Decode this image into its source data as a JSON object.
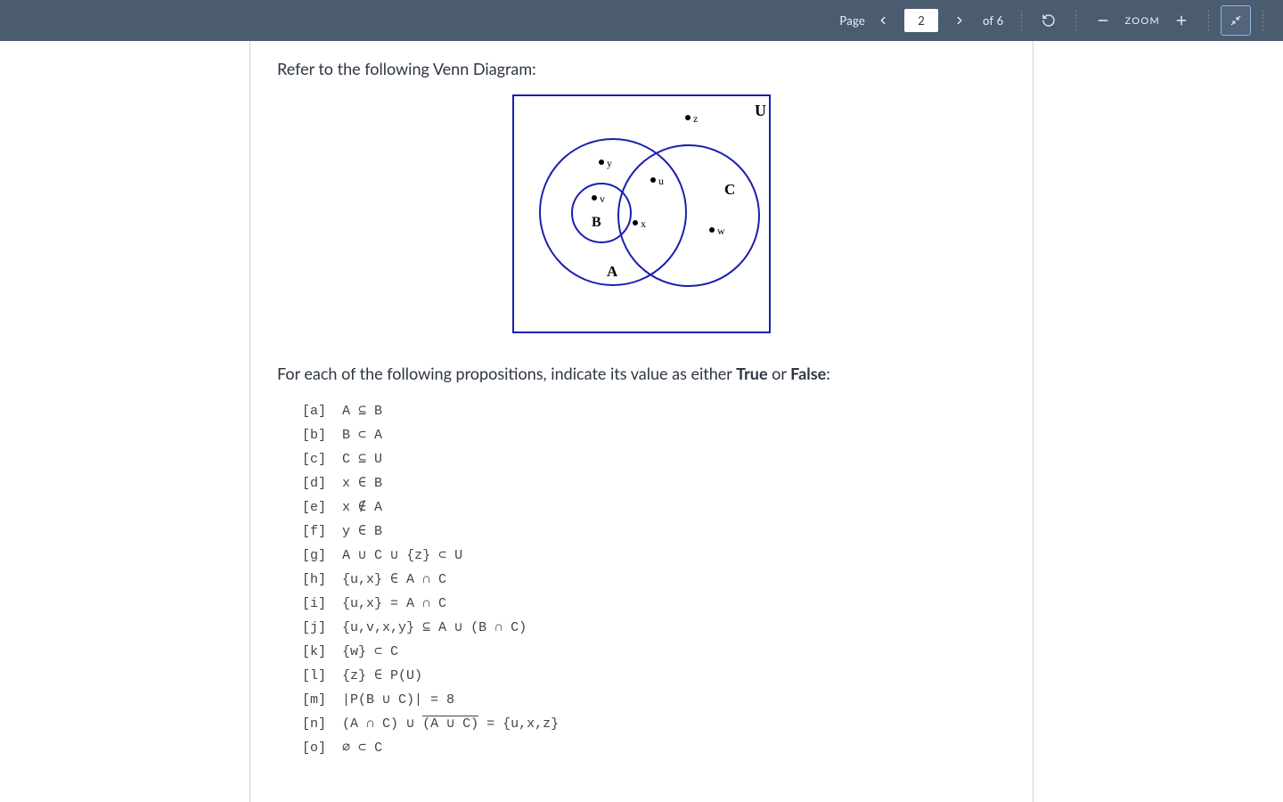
{
  "toolbar": {
    "page_label": "Page",
    "page_value": "2",
    "of_label": "of 6",
    "zoom_label": "ZOOM"
  },
  "content": {
    "prompt": "Refer to the following Venn Diagram:",
    "instruction_pre": "For each of the following propositions, indicate its value as either ",
    "true_word": "True",
    "or_word": " or ",
    "false_word": "False",
    "colon": ":"
  },
  "propositions": [
    {
      "tag": "[a]",
      "expr": "A ⊆ B"
    },
    {
      "tag": "[b]",
      "expr": "B ⊂ A"
    },
    {
      "tag": "[c]",
      "expr": "C ⊆ U"
    },
    {
      "tag": "[d]",
      "expr": "x ∈ B"
    },
    {
      "tag": "[e]",
      "expr": "x ∉ A"
    },
    {
      "tag": "[f]",
      "expr": "y ∈ B"
    },
    {
      "tag": "[g]",
      "expr": "A ∪ C ∪ {z} ⊂ U"
    },
    {
      "tag": "[h]",
      "expr": "{u,x} ∈ A ∩ C"
    },
    {
      "tag": "[i]",
      "expr": "{u,x} = A ∩ C"
    },
    {
      "tag": "[j]",
      "expr": "{u,v,x,y} ⊆ A ∪ (B ∩ C)"
    },
    {
      "tag": "[k]",
      "expr": "{w} ⊂ C"
    },
    {
      "tag": "[l]",
      "expr": "{z} ∈ P(U)"
    },
    {
      "tag": "[m]",
      "expr": "|P(B ∪ C)| = 8"
    },
    {
      "tag": "[n]",
      "expr_pre": "(A ∩ C) ∪ ",
      "expr_over": "(A ∪ C)",
      "expr_post": " = {u,x,z}"
    },
    {
      "tag": "[o]",
      "expr": "∅ ⊂ C"
    }
  ],
  "venn": {
    "U": "U",
    "A": "A",
    "B": "B",
    "C": "C",
    "u": "u",
    "v": "v",
    "w": "w",
    "x": "x",
    "y": "y",
    "z": "z"
  }
}
